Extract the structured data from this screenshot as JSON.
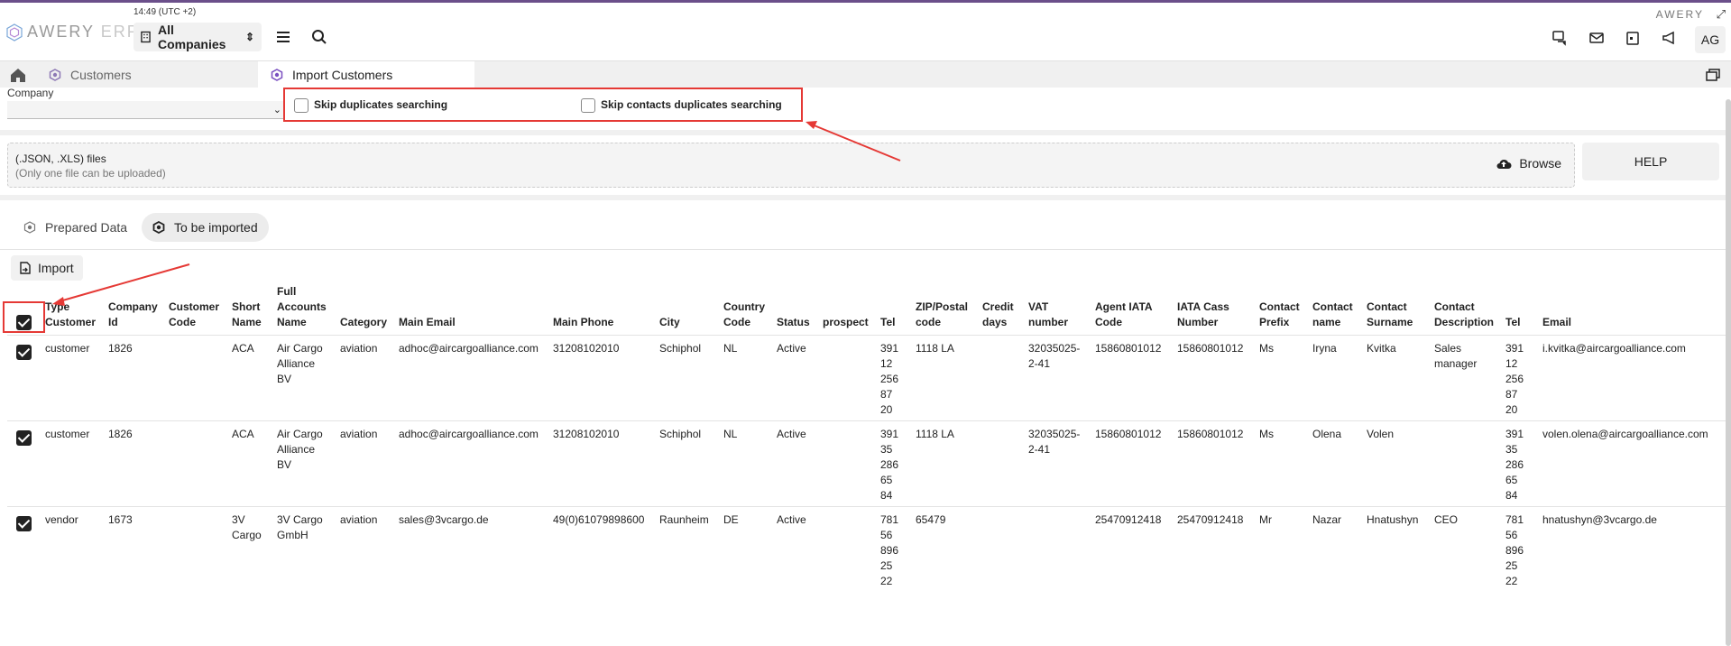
{
  "header": {
    "time": "14:49 (UTC +2)",
    "logo_a": "AWERY",
    "logo_b": "ERP",
    "right_logo": "AWERY",
    "company_select": "All Companies",
    "avatar": "AG",
    "icons": [
      "chat-icon",
      "mail-icon",
      "calendar-icon",
      "megaphone-icon"
    ]
  },
  "tabs": {
    "customers": "Customers",
    "import": "Import Customers"
  },
  "form": {
    "company_label": "Company",
    "skip_duplicates": "Skip duplicates searching",
    "skip_contacts_duplicates": "Skip contacts duplicates searching"
  },
  "upload": {
    "title": "(.JSON, .XLS) files",
    "subtitle": "(Only one file can be uploaded)",
    "browse": "Browse",
    "help": "HELP"
  },
  "subtabs": {
    "prepared": "Prepared Data",
    "tobe": "To be imported"
  },
  "import_label": "Import",
  "table": {
    "columns": [
      [
        "Type",
        "Customer"
      ],
      [
        "Company",
        "Id"
      ],
      [
        "Customer",
        "Code"
      ],
      [
        "Short",
        "Name"
      ],
      [
        "Full",
        "Accounts",
        "Name"
      ],
      [
        "Category"
      ],
      [
        "Main Email"
      ],
      [
        "Main Phone"
      ],
      [
        "City"
      ],
      [
        "Country",
        "Code"
      ],
      [
        "Status"
      ],
      [
        "prospect"
      ],
      [
        "Tel"
      ],
      [
        "ZIP/Postal",
        "code"
      ],
      [
        "Credit",
        "days"
      ],
      [
        "VAT",
        "number"
      ],
      [
        "Agent IATA",
        "Code"
      ],
      [
        "IATA Cass",
        "Number"
      ],
      [
        "Contact",
        "Prefix"
      ],
      [
        "Contact",
        "name"
      ],
      [
        "Contact",
        "Surname"
      ],
      [
        "Contact",
        "Description"
      ],
      [
        "Tel"
      ],
      [
        "Email"
      ]
    ],
    "rows": [
      [
        [
          "customer"
        ],
        [
          "1826"
        ],
        [
          ""
        ],
        [
          "ACA"
        ],
        [
          "Air Cargo",
          "Alliance",
          "BV"
        ],
        [
          "aviation"
        ],
        [
          "adhoc@aircargoalliance.com"
        ],
        [
          "31208102010"
        ],
        [
          "Schiphol"
        ],
        [
          "NL"
        ],
        [
          "Active"
        ],
        [
          ""
        ],
        [
          "391",
          "12",
          "256",
          "87",
          "20"
        ],
        [
          "1118 LA"
        ],
        [
          ""
        ],
        [
          "32035025-",
          "2-41"
        ],
        [
          "15860801012"
        ],
        [
          "15860801012"
        ],
        [
          "Ms"
        ],
        [
          "Iryna"
        ],
        [
          "Kvitka"
        ],
        [
          "Sales",
          "manager"
        ],
        [
          "391",
          "12",
          "256",
          "87",
          "20"
        ],
        [
          "i.kvitka@aircargoalliance.com"
        ]
      ],
      [
        [
          "customer"
        ],
        [
          "1826"
        ],
        [
          ""
        ],
        [
          "ACA"
        ],
        [
          "Air Cargo",
          "Alliance",
          "BV"
        ],
        [
          "aviation"
        ],
        [
          "adhoc@aircargoalliance.com"
        ],
        [
          "31208102010"
        ],
        [
          "Schiphol"
        ],
        [
          "NL"
        ],
        [
          "Active"
        ],
        [
          ""
        ],
        [
          "391",
          "35",
          "286",
          "65",
          "84"
        ],
        [
          "1118 LA"
        ],
        [
          ""
        ],
        [
          "32035025-",
          "2-41"
        ],
        [
          "15860801012"
        ],
        [
          "15860801012"
        ],
        [
          "Ms"
        ],
        [
          "Olena"
        ],
        [
          "Volen"
        ],
        [
          ""
        ],
        [
          "391",
          "35",
          "286",
          "65",
          "84"
        ],
        [
          "volen.olena@aircargoalliance.com"
        ]
      ],
      [
        [
          "vendor"
        ],
        [
          "1673"
        ],
        [
          ""
        ],
        [
          "3V",
          "Cargo"
        ],
        [
          "3V Cargo",
          "GmbH"
        ],
        [
          "aviation"
        ],
        [
          "sales@3vcargo.de"
        ],
        [
          "49(0)61079898600"
        ],
        [
          "Raunheim"
        ],
        [
          "DE"
        ],
        [
          "Active"
        ],
        [
          ""
        ],
        [
          "781",
          "56",
          "896",
          "25",
          "22"
        ],
        [
          "65479"
        ],
        [
          ""
        ],
        [
          ""
        ],
        [
          "25470912418"
        ],
        [
          "25470912418"
        ],
        [
          "Mr"
        ],
        [
          "Nazar"
        ],
        [
          "Hnatushyn"
        ],
        [
          "CEO"
        ],
        [
          "781",
          "56",
          "896",
          "25",
          "22"
        ],
        [
          "hnatushyn@3vcargo.de"
        ]
      ]
    ]
  }
}
